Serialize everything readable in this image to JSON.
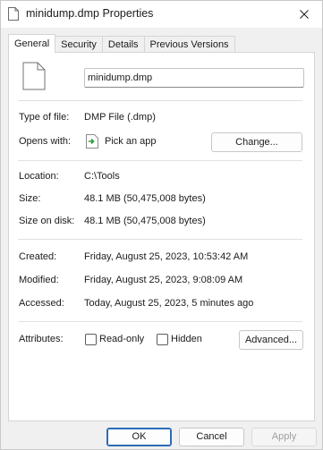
{
  "window": {
    "title": "minidump.dmp Properties",
    "close_icon": "close-icon"
  },
  "tabs": [
    {
      "label": "General",
      "active": true
    },
    {
      "label": "Security",
      "active": false
    },
    {
      "label": "Details",
      "active": false
    },
    {
      "label": "Previous Versions",
      "active": false
    }
  ],
  "general": {
    "file_name": "minidump.dmp",
    "type_label": "Type of file:",
    "type_value": "DMP File (.dmp)",
    "opens_label": "Opens with:",
    "opens_value": "Pick an app",
    "change_button": "Change...",
    "location_label": "Location:",
    "location_value": "C:\\Tools",
    "size_label": "Size:",
    "size_value": "48.1 MB (50,475,008 bytes)",
    "size_on_disk_label": "Size on disk:",
    "size_on_disk_value": "48.1 MB (50,475,008 bytes)",
    "created_label": "Created:",
    "created_value": "Friday, August 25, 2023, 10:53:42 AM",
    "modified_label": "Modified:",
    "modified_value": "Friday, August 25, 2023, 9:08:09 AM",
    "accessed_label": "Accessed:",
    "accessed_value": "Today, August 25, 2023, 5 minutes ago",
    "attributes_label": "Attributes:",
    "readonly_label": "Read-only",
    "readonly_checked": false,
    "hidden_label": "Hidden",
    "hidden_checked": false,
    "advanced_button": "Advanced..."
  },
  "footer": {
    "ok": "OK",
    "cancel": "Cancel",
    "apply": "Apply"
  },
  "colors": {
    "accent": "#2b6cb8",
    "app_icon_green": "#2e9b3e"
  }
}
